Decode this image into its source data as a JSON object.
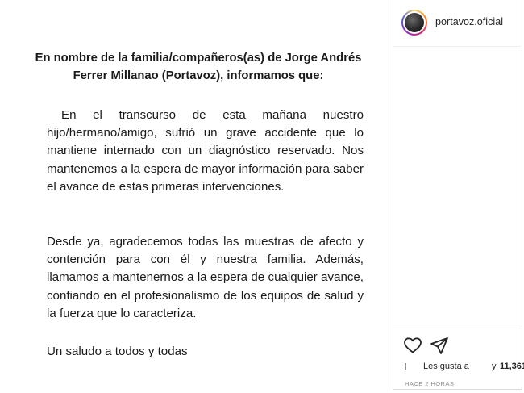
{
  "post": {
    "title": "En nombre de la familia/compañeros(as) de Jorge Andrés Ferrer Millanao (Portavoz), informamos que:",
    "paragraph_1": "En el transcurso de esta mañana nuestro hijo/hermano/amigo, sufrió un grave accidente que lo mantiene internado con un diagnóstico reservado. Nos mantenemos a la espera de mayor información para saber el avance de estas primeras intervenciones.",
    "paragraph_2": "Desde ya, agradecemos todas las muestras de afecto y contención para con él y nuestra familia. Además, llamamos a mantenernos a la espera de cualquier avance, confiando en el profesionalismo de los equipos de salud y la fuerza que lo caracteriza.",
    "paragraph_3": "Un saludo a todos y todas"
  },
  "header": {
    "username": "portavoz.oficial",
    "avatar_icon": "profile-photo"
  },
  "actions": {
    "like_icon": "heart-icon",
    "share_icon": "paper-plane-icon",
    "likes_label": "Les gusta a",
    "likes_connector": "y",
    "likes_count": "11,361",
    "timestamp": "HACE 2 HORAS"
  },
  "colors": {
    "text": "#1a1a1a",
    "muted": "#8e8e8e",
    "border": "#dbdbdb",
    "avatar_ring": "#d62976"
  }
}
